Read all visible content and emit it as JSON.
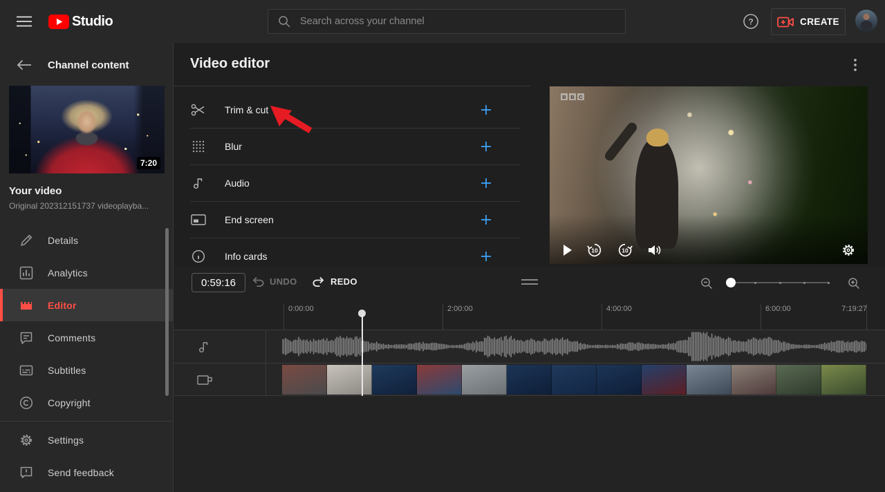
{
  "topbar": {
    "logo_text": "Studio",
    "search_placeholder": "Search across your channel",
    "create_label": "CREATE"
  },
  "sidebar": {
    "header": "Channel content",
    "video": {
      "duration": "7:20",
      "title": "Your video",
      "subtitle": "Original 202312151737 videoplayba..."
    },
    "items": [
      {
        "label": "Details"
      },
      {
        "label": "Analytics"
      },
      {
        "label": "Editor"
      },
      {
        "label": "Comments"
      },
      {
        "label": "Subtitles"
      },
      {
        "label": "Copyright"
      }
    ],
    "footer_items": [
      {
        "label": "Settings"
      },
      {
        "label": "Send feedback"
      }
    ]
  },
  "main": {
    "title": "Video editor",
    "tools": [
      {
        "label": "Trim & cut"
      },
      {
        "label": "Blur"
      },
      {
        "label": "Audio"
      },
      {
        "label": "End screen"
      },
      {
        "label": "Info cards"
      }
    ]
  },
  "preview": {
    "watermark": "BBC",
    "rewind_seconds": "10",
    "forward_seconds": "10"
  },
  "timeline": {
    "current_time": "0:59:16",
    "undo_label": "UNDO",
    "redo_label": "REDO",
    "ruler_labels": [
      "0:00:00",
      "2:00:00",
      "4:00:00",
      "6:00:00",
      "7:19:27"
    ],
    "video_thumbnails": [
      [
        "#7a4a42",
        "#4a4a4c"
      ],
      [
        "#c8c4bc",
        "#8a8782"
      ],
      [
        "#1e3a5c",
        "#10203a"
      ],
      [
        "#8b3a3a",
        "#2c4a6e"
      ],
      [
        "#9aa0a2",
        "#6a7074"
      ],
      [
        "#1c3556",
        "#0e1e38"
      ],
      [
        "#20395c",
        "#122644"
      ],
      [
        "#1c3556",
        "#0e1e38"
      ],
      [
        "#24406a",
        "#5c1e24"
      ],
      [
        "#7a8694",
        "#3e4a58"
      ],
      [
        "#8c8178",
        "#4e3a3a"
      ],
      [
        "#5a6a52",
        "#2e3a2c"
      ],
      [
        "#7a8a4a",
        "#3a4a2e"
      ]
    ]
  },
  "colors": {
    "accent_red": "#ff4e45",
    "youtube_red": "#ff0000",
    "accent_blue": "#3ea6ff",
    "annotation_red": "#e61b23",
    "waveform_gray": "#8a8a8a"
  }
}
